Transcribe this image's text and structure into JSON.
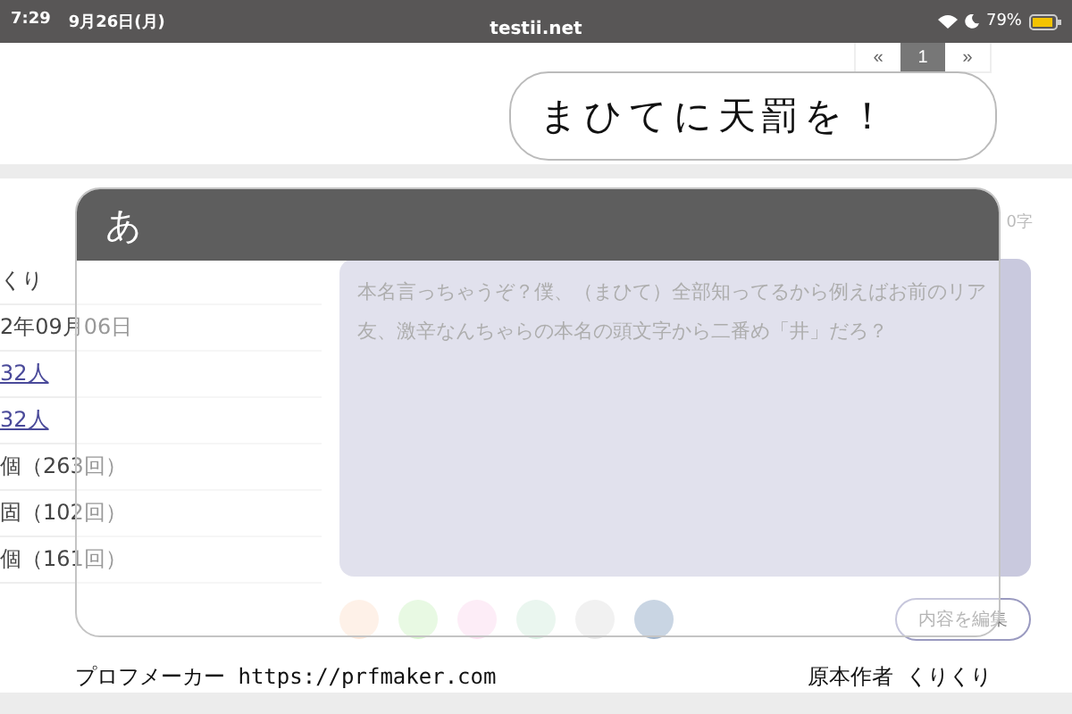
{
  "status_bar": {
    "time": "7:29",
    "date": "9月26日(月)",
    "url": "testii.net",
    "battery": "79%"
  },
  "pagination": [
    {
      "label": "«",
      "selected": false
    },
    {
      "label": "1",
      "selected": true
    },
    {
      "label": "»",
      "selected": false
    }
  ],
  "speech_bubble": "まひてに天罰を！",
  "char_count": "0字",
  "profile_rows": [
    {
      "kind": "text",
      "text": "くり"
    },
    {
      "kind": "text",
      "text": "2年09月06日"
    },
    {
      "kind": "link",
      "text": "32人"
    },
    {
      "kind": "link",
      "text": "32人"
    },
    {
      "kind": "text",
      "text": "個（263回）"
    },
    {
      "kind": "text",
      "text": "固（102回）"
    },
    {
      "kind": "text",
      "text": "個（161回）"
    }
  ],
  "overlay": {
    "title": "あ"
  },
  "message": "本名言っちゃうぞ？僕、（まひて）全部知ってるから例えばお前のリア友、激辛なんちゃらの本名の頭文字から二番め「井」だろ？",
  "color_dots": [
    {
      "color": "#fde6d6"
    },
    {
      "color": "#d6f5cc"
    },
    {
      "color": "#fbdff0"
    },
    {
      "color": "#d9efe2"
    },
    {
      "color": "#e6e6e6"
    },
    {
      "color": "#9db3cc"
    }
  ],
  "edit_button": "内容を編集",
  "footer": {
    "left": "プロフメーカー https://prfmaker.com",
    "right": "原本作者 くりくり"
  }
}
